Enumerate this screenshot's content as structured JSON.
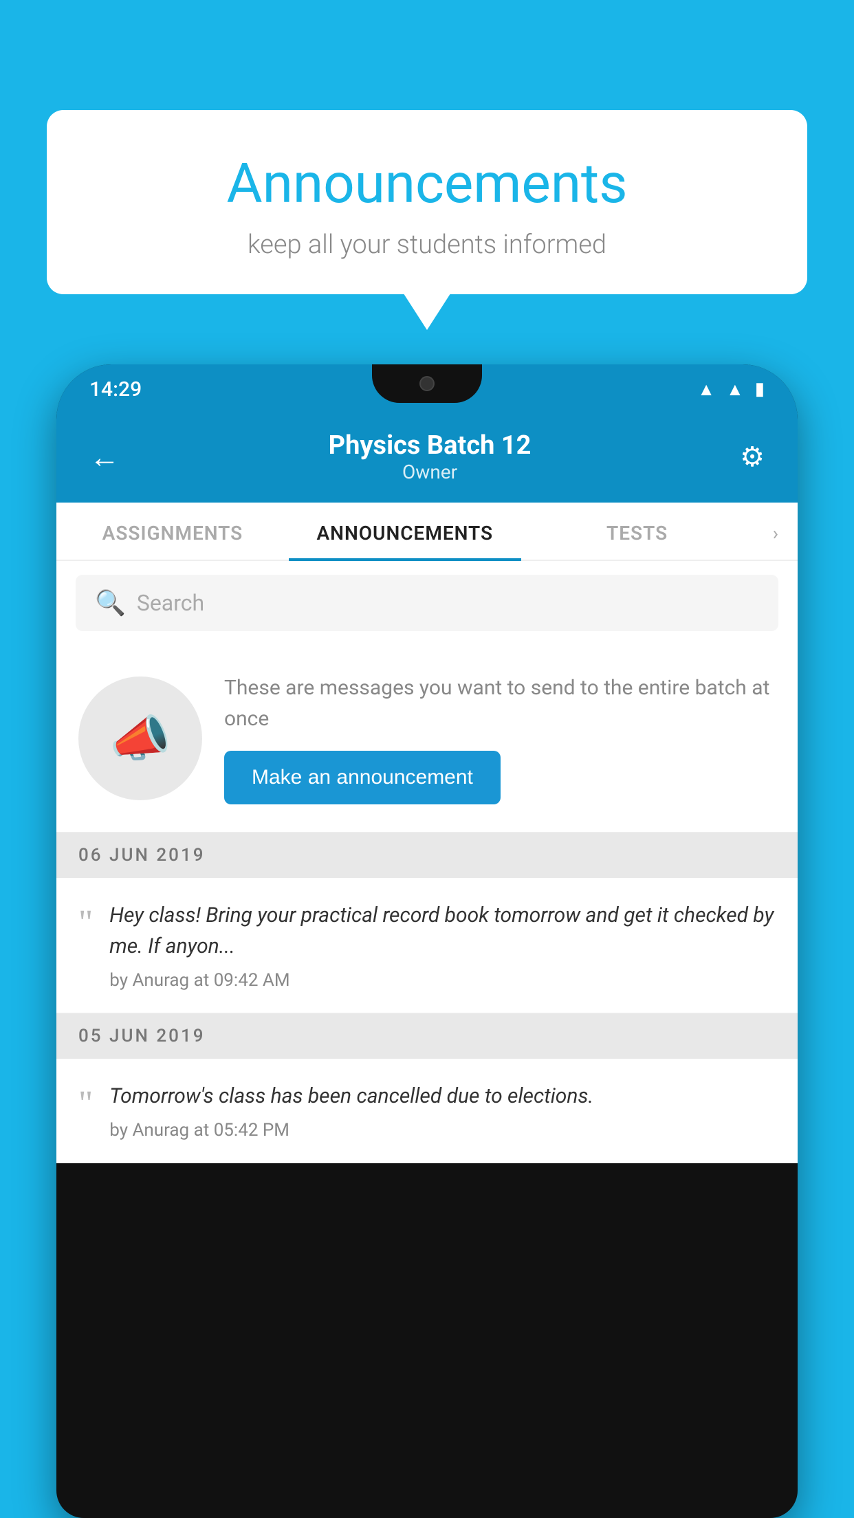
{
  "background_color": "#1ab5e8",
  "speech_bubble": {
    "title": "Announcements",
    "subtitle": "keep all your students informed"
  },
  "status_bar": {
    "time": "14:29",
    "icons": [
      "▲",
      "▲",
      "▮"
    ]
  },
  "header": {
    "title": "Physics Batch 12",
    "subtitle": "Owner",
    "back_label": "←",
    "gear_label": "⚙"
  },
  "tabs": [
    {
      "label": "ASSIGNMENTS",
      "active": false
    },
    {
      "label": "ANNOUNCEMENTS",
      "active": true
    },
    {
      "label": "TESTS",
      "active": false
    }
  ],
  "search": {
    "placeholder": "Search"
  },
  "promo": {
    "text": "These are messages you want to send to the entire batch at once",
    "button_label": "Make an announcement"
  },
  "announcements": [
    {
      "date": "06  JUN  2019",
      "text": "Hey class! Bring your practical record book tomorrow and get it checked by me. If anyon...",
      "meta": "by Anurag at 09:42 AM"
    },
    {
      "date": "05  JUN  2019",
      "text": "Tomorrow's class has been cancelled due to elections.",
      "meta": "by Anurag at 05:42 PM"
    }
  ]
}
